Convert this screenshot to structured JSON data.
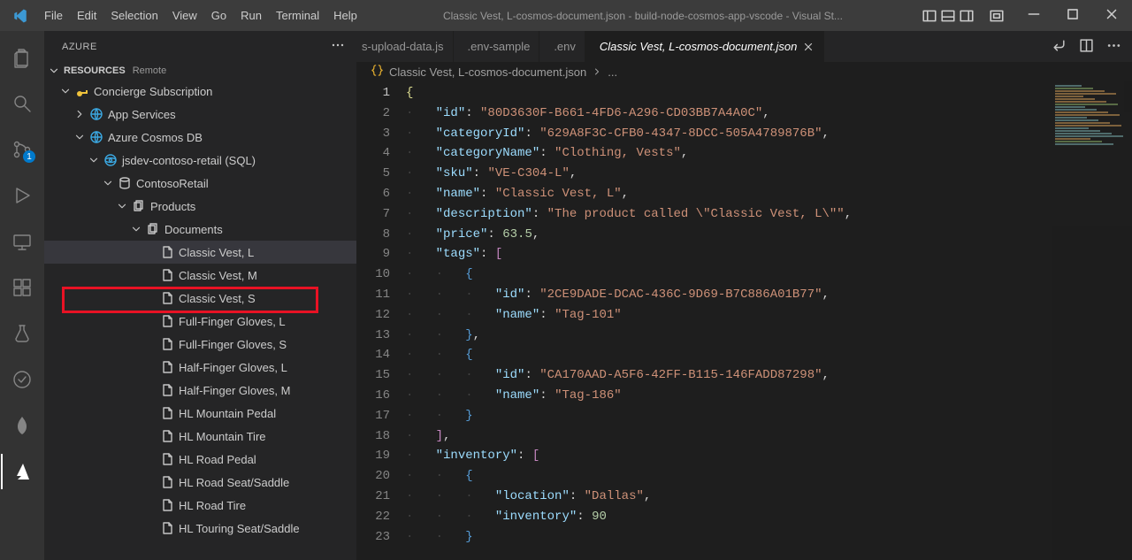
{
  "titlebar": {
    "menus": [
      "File",
      "Edit",
      "Selection",
      "View",
      "Go",
      "Run",
      "Terminal",
      "Help"
    ],
    "title": "Classic Vest, L-cosmos-document.json - build-node-cosmos-app-vscode - Visual St..."
  },
  "activitybar": {
    "badge": "1"
  },
  "sidebar": {
    "title": "AZURE",
    "section": {
      "label": "RESOURCES",
      "extra": "Remote"
    },
    "tree": [
      {
        "depth": 0,
        "twisty": "down",
        "icon": "key",
        "label": "Concierge Subscription"
      },
      {
        "depth": 1,
        "twisty": "right",
        "icon": "globe",
        "label": "App Services"
      },
      {
        "depth": 1,
        "twisty": "down",
        "icon": "globe",
        "label": "Azure Cosmos DB"
      },
      {
        "depth": 2,
        "twisty": "down",
        "icon": "cosmos",
        "label": "jsdev-contoso-retail (SQL)"
      },
      {
        "depth": 3,
        "twisty": "down",
        "icon": "db",
        "label": "ContosoRetail"
      },
      {
        "depth": 4,
        "twisty": "down",
        "icon": "files",
        "label": "Products"
      },
      {
        "depth": 5,
        "twisty": "down",
        "icon": "files",
        "label": "Documents"
      },
      {
        "depth": 6,
        "twisty": "",
        "icon": "file",
        "label": "Classic Vest, L",
        "selected": true,
        "highlight": true
      },
      {
        "depth": 6,
        "twisty": "",
        "icon": "file",
        "label": "Classic Vest, M"
      },
      {
        "depth": 6,
        "twisty": "",
        "icon": "file",
        "label": "Classic Vest, S"
      },
      {
        "depth": 6,
        "twisty": "",
        "icon": "file",
        "label": "Full-Finger Gloves, L"
      },
      {
        "depth": 6,
        "twisty": "",
        "icon": "file",
        "label": "Full-Finger Gloves, S"
      },
      {
        "depth": 6,
        "twisty": "",
        "icon": "file",
        "label": "Half-Finger Gloves, L"
      },
      {
        "depth": 6,
        "twisty": "",
        "icon": "file",
        "label": "Half-Finger Gloves, M"
      },
      {
        "depth": 6,
        "twisty": "",
        "icon": "file",
        "label": "HL Mountain Pedal"
      },
      {
        "depth": 6,
        "twisty": "",
        "icon": "file",
        "label": "HL Mountain Tire"
      },
      {
        "depth": 6,
        "twisty": "",
        "icon": "file",
        "label": "HL Road Pedal"
      },
      {
        "depth": 6,
        "twisty": "",
        "icon": "file",
        "label": "HL Road Seat/Saddle"
      },
      {
        "depth": 6,
        "twisty": "",
        "icon": "file",
        "label": "HL Road Tire"
      },
      {
        "depth": 6,
        "twisty": "",
        "icon": "file",
        "label": "HL Touring Seat/Saddle"
      }
    ]
  },
  "tabs": {
    "items": [
      {
        "icon": "js",
        "label": "s-upload-data.js",
        "active": false,
        "truncatedLeft": true
      },
      {
        "icon": "gear",
        "label": ".env-sample",
        "active": false
      },
      {
        "icon": "gear",
        "label": ".env",
        "active": false
      },
      {
        "icon": "brace",
        "label": "Classic Vest, L-cosmos-document.json",
        "active": true,
        "close": true
      }
    ]
  },
  "breadcrumb": {
    "file": "Classic Vest, L-cosmos-document.json",
    "tail": "..."
  },
  "json": {
    "id": "80D3630F-B661-4FD6-A296-CD03BB7A4A0C",
    "categoryId": "629A8F3C-CFB0-4347-8DCC-505A4789876B",
    "categoryName": "Clothing, Vests",
    "sku": "VE-C304-L",
    "name": "Classic Vest, L",
    "description": "The product called \\\"Classic Vest, L\\\"",
    "price": 63.5,
    "tags": [
      {
        "id": "2CE9DADE-DCAC-436C-9D69-B7C886A01B77",
        "name": "Tag-101"
      },
      {
        "id": "CA170AAD-A5F6-42FF-B115-146FADD87298",
        "name": "Tag-186"
      }
    ],
    "inventory": [
      {
        "location": "Dallas",
        "inventory": 90
      }
    ]
  },
  "lineStart": 1,
  "lineCount": 23
}
